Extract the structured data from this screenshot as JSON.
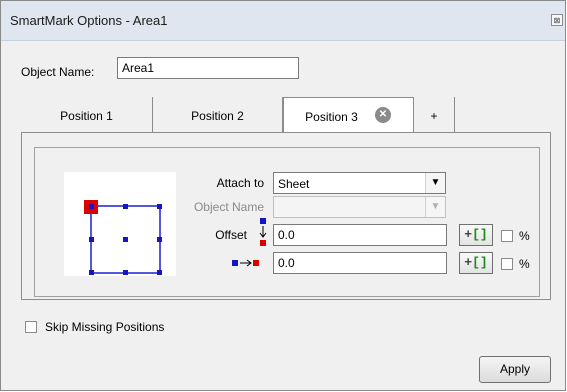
{
  "window": {
    "title": "SmartMark Options - Area1",
    "close_glyph": "⊠"
  },
  "object_name": {
    "label": "Object Name:",
    "value": "Area1"
  },
  "tabs": [
    {
      "label": "Position 1"
    },
    {
      "label": "Position 2"
    },
    {
      "label": "Position 3",
      "active": true,
      "close_glyph": "✕"
    },
    {
      "label": "+"
    }
  ],
  "position": {
    "attach_to": {
      "label": "Attach to",
      "value": "Sheet"
    },
    "object_name": {
      "label": "Object Name",
      "value": ""
    },
    "offset": {
      "label": "Offset",
      "value": "0.0"
    },
    "offset_horizontal": {
      "value": "0.0"
    },
    "bracket_button": {
      "plus": "+",
      "brackets": "[]"
    },
    "percent_label": "%"
  },
  "skip_missing": {
    "label": "Skip Missing Positions",
    "checked": false
  },
  "apply_button": "Apply",
  "colors": {
    "handle": "#1515c8",
    "selected_anchor": "#d90000",
    "outline": "#1f1fd0"
  }
}
